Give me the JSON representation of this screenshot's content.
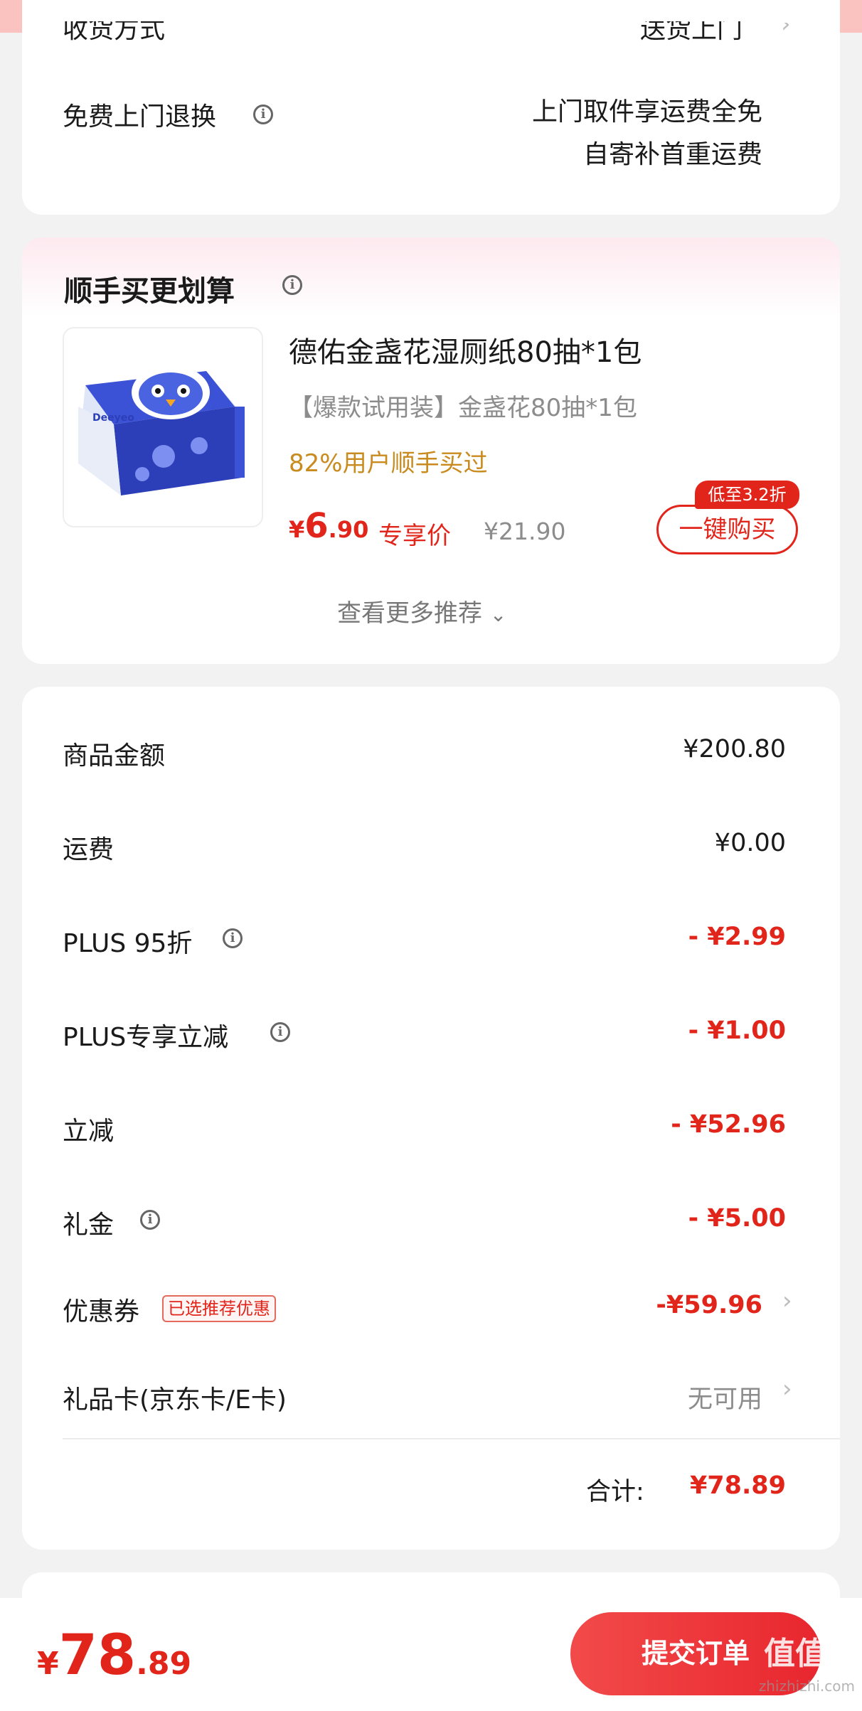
{
  "shipping": {
    "method_label": "收货方式",
    "method_value": "送货上门",
    "return_label": "免费上门退换",
    "return_value_line1": "上门取件享运费全免",
    "return_value_line2": "自寄补首重运费"
  },
  "recommend": {
    "title": "顺手买更划算",
    "product": {
      "name": "德佑金盏花湿厕纸80抽*1包",
      "spec": "【爆款试用装】金盏花80抽*1包",
      "social_proof": "82%用户顺手买过",
      "price_symbol": "¥",
      "price_int": "6",
      "price_dec": ".90",
      "price_tag": "专享价",
      "original_price": "¥21.90",
      "discount_badge": "低至3.2折",
      "buy_button": "一键购买",
      "image_brand_text": "Deeyeo"
    },
    "more_link": "查看更多推荐"
  },
  "summary": {
    "rows": [
      {
        "label": "商品金额",
        "value": "¥200.80"
      },
      {
        "label": "运费",
        "value": "¥0.00"
      },
      {
        "label": "PLUS 95折",
        "value": "- ¥2.99"
      },
      {
        "label": "PLUS专享立减",
        "value": "- ¥1.00"
      },
      {
        "label": "立减",
        "value": "- ¥52.96"
      },
      {
        "label": "礼金",
        "value": "- ¥5.00"
      },
      {
        "label": "优惠券",
        "value": "-¥59.96",
        "badge": "已选推荐优惠"
      },
      {
        "label": "礼品卡(京东卡/E卡)",
        "value": "无可用"
      }
    ],
    "total_label": "合计:",
    "total_value": "¥78.89"
  },
  "bottom": {
    "price_symbol": "¥",
    "price_int": "78",
    "price_dec": ".89",
    "submit": "提交订单"
  },
  "watermark": {
    "text": "值值值",
    "sub": "zhizhizhi.com"
  },
  "colors": {
    "accent_red": "#e1251b",
    "price_orange": "#c98a1e",
    "background": "#f2f2f2"
  }
}
